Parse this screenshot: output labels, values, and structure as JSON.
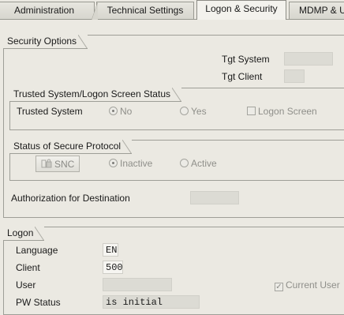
{
  "tabs": [
    {
      "label": "Administration"
    },
    {
      "label": "Technical Settings"
    },
    {
      "label": "Logon & Security"
    },
    {
      "label": "MDMP & U"
    }
  ],
  "security_options": {
    "title": "Security Options",
    "tgt_system_label": "Tgt System",
    "tgt_system_value": "",
    "tgt_client_label": "Tgt Client",
    "tgt_client_value": ""
  },
  "trusted": {
    "title": "Trusted System/Logon Screen Status",
    "label": "Trusted System",
    "no_label": "No",
    "yes_label": "Yes",
    "logon_screen_label": "Logon Screen",
    "selected": "No"
  },
  "secure_protocol": {
    "title": "Status of Secure Protocol",
    "snc_button": "SNC",
    "inactive_label": "Inactive",
    "active_label": "Active",
    "selected": "Inactive"
  },
  "authorization": {
    "label": "Authorization for Destination",
    "value": ""
  },
  "logon": {
    "title": "Logon",
    "language_label": "Language",
    "language_value": "EN",
    "client_label": "Client",
    "client_value": "500",
    "user_label": "User",
    "user_value": "",
    "current_user_label": "Current User",
    "current_user_checked": true,
    "pw_status_label": "PW Status",
    "pw_status_value": "is initial"
  }
}
